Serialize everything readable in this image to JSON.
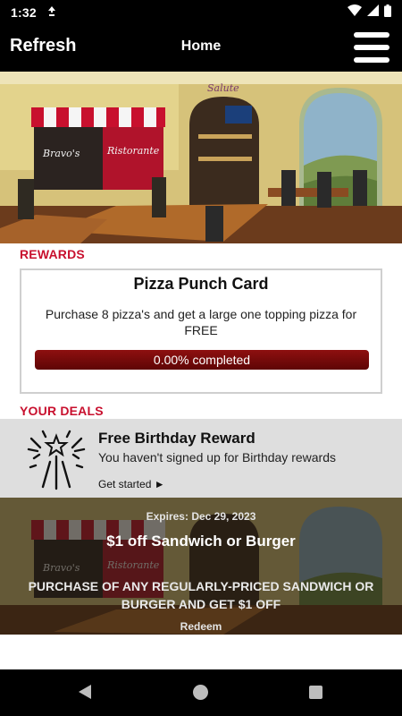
{
  "status": {
    "time": "1:32",
    "icons": [
      "data-saver-icon",
      "wifi-icon",
      "cell-signal-icon",
      "battery-icon"
    ]
  },
  "appbar": {
    "refresh_label": "Refresh",
    "title": "Home",
    "menu_icon": "hamburger-menu-icon"
  },
  "hero": {
    "sign_text": "Salute",
    "awning_left": "Bravo's",
    "awning_right": "Ristorante"
  },
  "rewards": {
    "section_label": "REWARDS",
    "card_title": "Pizza Punch Card",
    "card_description": "Purchase 8 pizza's and get a large one topping pizza for FREE",
    "progress_text": "0.00% completed",
    "progress_fraction": 0.0
  },
  "deals": {
    "section_label": "YOUR DEALS",
    "birthday": {
      "icon": "fireworks-icon",
      "title": "Free Birthday Reward",
      "subtitle": "You haven't signed up for Birthday rewards",
      "cta": "Get started ►"
    },
    "sandwich": {
      "expiry": "Expires: Dec 29, 2023",
      "title": "$1 off Sandwich or Burger",
      "description": "PURCHASE OF ANY REGULARLY-PRICED SANDWICH OR BURGER AND GET $1 OFF",
      "cta": "Redeem"
    }
  },
  "navbar": {
    "icons": [
      "back-icon",
      "home-icon",
      "recents-icon"
    ]
  },
  "colors": {
    "accent_red": "#c8102e",
    "progress_dark_red": "#6e0909",
    "bar_black": "#000000",
    "birthday_bg": "#dedede"
  }
}
